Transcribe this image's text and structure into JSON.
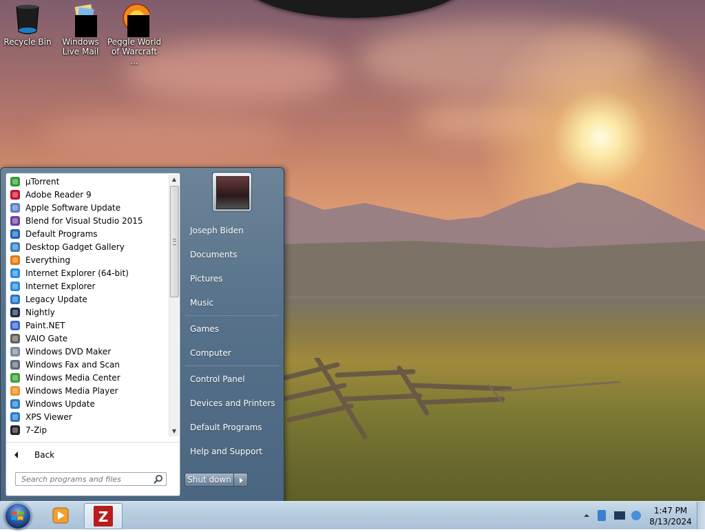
{
  "desktop": {
    "icons": [
      {
        "label": "Recycle Bin",
        "icon": "recycle-bin-icon"
      },
      {
        "label": "Windows Live Mail",
        "icon": "windows-live-mail-icon"
      },
      {
        "label": "Peggle World of Warcraft ...",
        "icon": "peggle-icon"
      }
    ]
  },
  "start_menu": {
    "programs": [
      {
        "label": "µTorrent",
        "icon": "utorrent-icon",
        "color": "#2e9b2e"
      },
      {
        "label": "Adobe Reader 9",
        "icon": "adobe-reader-icon",
        "color": "#c8102e"
      },
      {
        "label": "Apple Software Update",
        "icon": "apple-update-icon",
        "color": "#5a7fc8"
      },
      {
        "label": "Blend for Visual Studio 2015",
        "icon": "blend-icon",
        "color": "#6b3fa0"
      },
      {
        "label": "Default Programs",
        "icon": "default-programs-icon",
        "color": "#1f63b6"
      },
      {
        "label": "Desktop Gadget Gallery",
        "icon": "gadget-gallery-icon",
        "color": "#3a7fc0"
      },
      {
        "label": "Everything",
        "icon": "everything-icon",
        "color": "#e07a10"
      },
      {
        "label": "Internet Explorer (64-bit)",
        "icon": "internet-explorer-icon",
        "color": "#2a8ad6"
      },
      {
        "label": "Internet Explorer",
        "icon": "internet-explorer-icon",
        "color": "#2a8ad6"
      },
      {
        "label": "Legacy Update",
        "icon": "legacy-update-icon",
        "color": "#2a78c8"
      },
      {
        "label": "Nightly",
        "icon": "nightly-icon",
        "color": "#1a2a4a"
      },
      {
        "label": "Paint.NET",
        "icon": "paintnet-icon",
        "color": "#3a64c8"
      },
      {
        "label": "VAIO Gate",
        "icon": "vaio-gate-icon",
        "color": "#606060"
      },
      {
        "label": "Windows DVD Maker",
        "icon": "dvd-maker-icon",
        "color": "#7a8a9a"
      },
      {
        "label": "Windows Fax and Scan",
        "icon": "fax-scan-icon",
        "color": "#5a6a7a"
      },
      {
        "label": "Windows Media Center",
        "icon": "media-center-icon",
        "color": "#3aa03a"
      },
      {
        "label": "Windows Media Player",
        "icon": "media-player-icon",
        "color": "#f09020"
      },
      {
        "label": "Windows Update",
        "icon": "windows-update-icon",
        "color": "#2a78c8"
      },
      {
        "label": "XPS Viewer",
        "icon": "xps-viewer-icon",
        "color": "#2a78c8"
      },
      {
        "label": "7-Zip",
        "icon": "seven-zip-icon",
        "color": "#222222"
      }
    ],
    "back_label": "Back",
    "search_placeholder": "Search programs and files",
    "right_items": {
      "user": "Joseph Biden",
      "documents": "Documents",
      "pictures": "Pictures",
      "music": "Music",
      "games": "Games",
      "computer": "Computer",
      "control_panel": "Control Panel",
      "devices": "Devices and Printers",
      "default_programs": "Default Programs",
      "help": "Help and Support"
    },
    "shutdown_label": "Shut down"
  },
  "taskbar": {
    "time": "1:47 PM",
    "date": "8/13/2024"
  },
  "colors": {
    "taskbar_top": "#c9dbea",
    "start_menu_right": "#56718a",
    "accent_green": "#29c04a"
  }
}
